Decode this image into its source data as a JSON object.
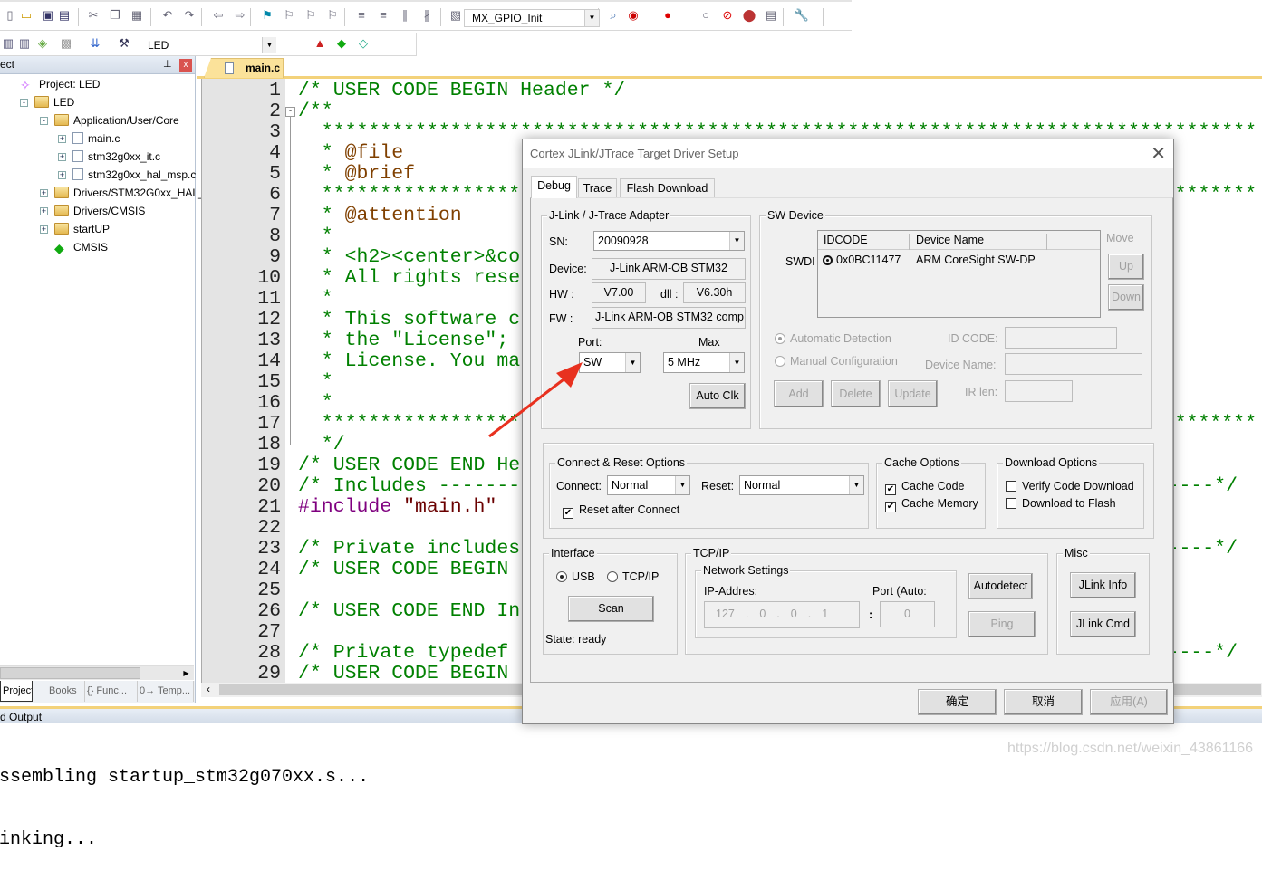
{
  "toolbar": {
    "function_combo": "MX_GPIO_Init",
    "target_combo": "LED",
    "icons": [
      "new-file-icon",
      "open-folder-icon",
      "save-icon",
      "save-all-icon",
      "cut-icon",
      "copy-icon",
      "paste-icon",
      "undo-icon",
      "redo-icon",
      "back-icon",
      "forward-icon",
      "bookmark-icon",
      "prev-bookmark-icon",
      "next-bookmark-icon",
      "clear-bookmarks-icon",
      "indent-icon",
      "unindent-icon",
      "comment-icon",
      "uncomment-icon",
      "find-in-files-icon",
      "find-icon",
      "debug-icon",
      "breakpoint-icon",
      "disable-breakpoint-icon",
      "disable-all-breakpoints-icon",
      "kill-breakpoints-icon",
      "window-layout-icon",
      "configure-icon"
    ],
    "icons2": [
      "build-icon",
      "rebuild-icon",
      "batch-build-icon",
      "stop-build-icon",
      "download-icon",
      "target-options-icon",
      "manage-components-icon",
      "select-pack-icon",
      "pack-installer-icon"
    ]
  },
  "project_panel": {
    "title": "ect",
    "tree": [
      {
        "label": "Project: LED",
        "level": 0,
        "icon": "project-icon"
      },
      {
        "label": "LED",
        "level": 1,
        "icon": "target-folder-icon",
        "toggle": "-"
      },
      {
        "label": "Application/User/Core",
        "level": 2,
        "icon": "folder-open-icon",
        "toggle": "-"
      },
      {
        "label": "main.c",
        "level": 3,
        "icon": "file-icon",
        "toggle": "+"
      },
      {
        "label": "stm32g0xx_it.c",
        "level": 3,
        "icon": "file-icon",
        "toggle": "+"
      },
      {
        "label": "stm32g0xx_hal_msp.c",
        "level": 3,
        "icon": "file-icon",
        "toggle": "+"
      },
      {
        "label": "Drivers/STM32G0xx_HAL_Dri",
        "level": 2,
        "icon": "folder-icon",
        "toggle": "+"
      },
      {
        "label": "Drivers/CMSIS",
        "level": 2,
        "icon": "folder-icon",
        "toggle": "+"
      },
      {
        "label": "startUP",
        "level": 2,
        "icon": "folder-icon",
        "toggle": "+"
      },
      {
        "label": "CMSIS",
        "level": 2,
        "icon": "component-icon"
      }
    ],
    "tabs": [
      "Project",
      "Books",
      "{} Func...",
      "0→ Temp..."
    ]
  },
  "editor": {
    "tab": "main.c",
    "lines": [
      {
        "n": "1",
        "parts": [
          {
            "t": "/* USER CODE BEGIN Header */"
          }
        ]
      },
      {
        "n": "2",
        "parts": [
          {
            "t": "/**"
          }
        ],
        "fold": true
      },
      {
        "n": "3",
        "parts": [
          {
            "t": "  ********************************************************************************"
          }
        ]
      },
      {
        "n": "4",
        "parts": [
          {
            "t": "  * "
          },
          {
            "t": "@file",
            "k": "tag"
          }
        ]
      },
      {
        "n": "5",
        "parts": [
          {
            "t": "  * "
          },
          {
            "t": "@brief",
            "k": "tag"
          }
        ]
      },
      {
        "n": "6",
        "parts": [
          {
            "t": "  ********************************************************************************"
          }
        ]
      },
      {
        "n": "7",
        "parts": [
          {
            "t": "  * "
          },
          {
            "t": "@attention",
            "k": "tag"
          }
        ]
      },
      {
        "n": "8",
        "parts": [
          {
            "t": "  *"
          }
        ]
      },
      {
        "n": "9",
        "parts": [
          {
            "t": "  * <h2><center>&co"
          }
        ]
      },
      {
        "n": "10",
        "parts": [
          {
            "t": "  * All rights rese"
          }
        ]
      },
      {
        "n": "11",
        "parts": [
          {
            "t": "  *"
          }
        ]
      },
      {
        "n": "12",
        "parts": [
          {
            "t": "  * This software c"
          }
        ]
      },
      {
        "n": "13",
        "parts": [
          {
            "t": "  * the \"License\";"
          }
        ]
      },
      {
        "n": "14",
        "parts": [
          {
            "t": "  * License. You ma"
          }
        ]
      },
      {
        "n": "15",
        "parts": [
          {
            "t": "  *"
          }
        ]
      },
      {
        "n": "16",
        "parts": [
          {
            "t": "  *"
          }
        ]
      },
      {
        "n": "17",
        "parts": [
          {
            "t": "  ********************************************************************************"
          }
        ]
      },
      {
        "n": "18",
        "parts": [
          {
            "t": "  */"
          }
        ]
      },
      {
        "n": "19",
        "parts": [
          {
            "t": "/* USER CODE END He"
          }
        ]
      },
      {
        "n": "20",
        "parts": [
          {
            "t": "/* Includes -------"
          }
        ],
        "right": "-----*/"
      },
      {
        "n": "21",
        "parts": [
          {
            "t": "#include ",
            "k": "pre"
          },
          {
            "t": "\"main.h\"",
            "k": "str"
          }
        ]
      },
      {
        "n": "22",
        "parts": []
      },
      {
        "n": "23",
        "parts": [
          {
            "t": "/* Private includes"
          }
        ],
        "right": "-----*/"
      },
      {
        "n": "24",
        "parts": [
          {
            "t": "/* USER CODE BEGIN"
          }
        ]
      },
      {
        "n": "25",
        "parts": []
      },
      {
        "n": "26",
        "parts": [
          {
            "t": "/* USER CODE END In"
          }
        ]
      },
      {
        "n": "27",
        "parts": []
      },
      {
        "n": "28",
        "parts": [
          {
            "t": "/* Private typedef"
          }
        ],
        "right": "-----*/"
      },
      {
        "n": "29",
        "parts": [
          {
            "t": "/* USER CODE BEGIN"
          }
        ]
      }
    ]
  },
  "output": {
    "title": "d Output",
    "lines": [
      "ssembling startup_stm32g070xx.s...",
      "inking..."
    ]
  },
  "watermark": "https://blog.csdn.net/weixin_43861166",
  "dialog": {
    "title": "Cortex JLink/JTrace Target Driver Setup",
    "tabs": [
      "Debug",
      "Trace",
      "Flash Download"
    ],
    "adapter": {
      "title": "J-Link / J-Trace Adapter",
      "sn_label": "SN:",
      "sn": "20090928",
      "device_label": "Device:",
      "device": "J-Link ARM-OB STM32",
      "hw_label": "HW :",
      "hw": "V7.00",
      "dll_label": "dll :",
      "dll": "V6.30h",
      "fw_label": "FW :",
      "fw": "J-Link ARM-OB STM32 comp",
      "port_label": "Port:",
      "port": "SW",
      "max_label": "Max",
      "max": "5 MHz",
      "auto_clk": "Auto Clk"
    },
    "sw_device": {
      "title": "SW Device",
      "row_label": "SWDI",
      "columns": [
        "IDCODE",
        "Device Name"
      ],
      "rows": [
        {
          "idcode": "0x0BC11477",
          "name": "ARM CoreSight SW-DP"
        }
      ],
      "move_label": "Move",
      "up": "Up",
      "down": "Down",
      "auto_detect": "Automatic Detection",
      "manual_config": "Manual Configuration",
      "mode": "auto",
      "idcode_label": "ID CODE:",
      "device_name_label": "Device Name:",
      "ir_len_label": "IR len:",
      "add": "Add",
      "delete": "Delete",
      "update": "Update"
    },
    "connect_reset": {
      "title": "Connect & Reset Options",
      "connect_label": "Connect:",
      "connect": "Normal",
      "reset_label": "Reset:",
      "reset": "Normal",
      "reset_after_connect": "Reset after Connect",
      "reset_after_connect_checked": true
    },
    "cache": {
      "title": "Cache Options",
      "code": "Cache Code",
      "code_checked": true,
      "memory": "Cache Memory",
      "memory_checked": true
    },
    "download": {
      "title": "Download Options",
      "verify": "Verify Code Download",
      "verify_checked": false,
      "flash": "Download to Flash",
      "flash_checked": false
    },
    "interface": {
      "title": "Interface",
      "usb": "USB",
      "tcpip": "TCP/IP",
      "selected": "USB",
      "scan": "Scan",
      "state": "State: ready"
    },
    "tcpip": {
      "title": "TCP/IP",
      "network_settings": "Network Settings",
      "ip_label": "IP-Addres:",
      "ip": [
        "127",
        "0",
        "0",
        "1"
      ],
      "port_label": "Port (Auto:",
      "port": "0",
      "colon": ":",
      "autodetect": "Autodetect",
      "ping": "Ping"
    },
    "misc": {
      "title": "Misc",
      "jlink_info": "JLink Info",
      "jlink_cmd": "JLink Cmd"
    },
    "buttons": {
      "ok": "确定",
      "cancel": "取消",
      "apply": "应用(A)"
    }
  },
  "colors": {
    "comment": "#008000",
    "tag": "#804000",
    "annotation_arrow": "#e8311f",
    "tab_active": "#fbe29a"
  }
}
